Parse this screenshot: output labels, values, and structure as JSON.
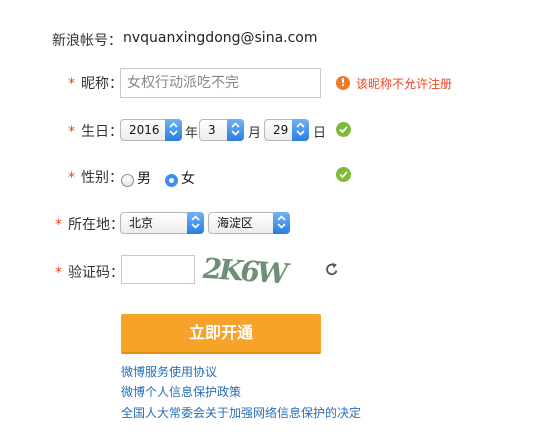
{
  "account": {
    "label": "新浪帐号：",
    "value": "nvquanxingdong@sina.com"
  },
  "required_mark": "*",
  "nickname": {
    "label": "昵称：",
    "value": "女权行动派吃不完",
    "error": "该昵称不允许注册"
  },
  "birthday": {
    "label": "生日：",
    "year": "2016",
    "year_unit": "年",
    "month": "3",
    "month_unit": "月",
    "day": "29",
    "day_unit": "日"
  },
  "gender": {
    "label": "性别：",
    "options": [
      "男",
      "女"
    ],
    "selected": "女"
  },
  "location": {
    "label": "所在地：",
    "province": "北京",
    "district": "海淀区"
  },
  "captcha": {
    "label": "验证码：",
    "value": "",
    "image_text": "2K6W"
  },
  "submit_label": "立即开通",
  "links": [
    "微博服务使用协议",
    "微博个人信息保护政策",
    "全国人大常委会关于加强网络信息保护的决定"
  ],
  "colors": {
    "accent": "#f7a32a",
    "error": "#e8461e",
    "link": "#2a6db3",
    "ok": "#7dba35"
  }
}
